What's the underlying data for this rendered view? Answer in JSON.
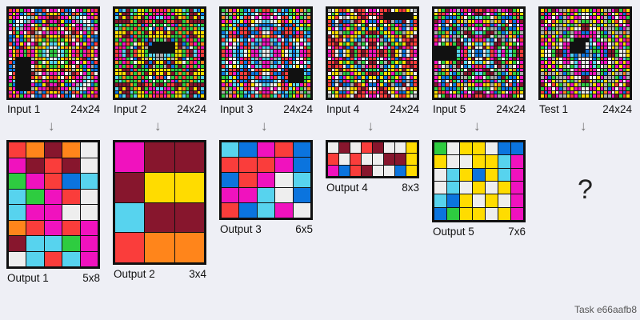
{
  "task_label": "Task e66aafb8",
  "test_unknown": "?",
  "arrow_glyph": "↓",
  "palette": {
    "K": "#111111",
    "B": "#0b74de",
    "R": "#fa3d3b",
    "G": "#2ecc40",
    "Y": "#ffdc00",
    "E": "#aaaaaa",
    "P": "#f012be",
    "O": "#ff851b",
    "C": "#57d3ee",
    "M": "#87162d",
    "W": "#eeeeee"
  },
  "inputs": [
    {
      "label": "Input 1",
      "size": "24x24",
      "rows": [
        "RPOGPPWBBRWPPWRBBWPPGOPR",
        "PYPBCORBEBOYYOBEBROCBPYP",
        "OPPWWCEYPPRMMRPPYECWWPPO",
        "GBWWCEPBBYMPPMYBBPECWWBG",
        "PCWCPPWYGPRGGRPGYWPPCWCP",
        "POCEPPRYRWYRRYWRYRPPECOP",
        "WRGPWRMEWPEPPEPWEMRWPGRW",
        "BBYBYYEOOMYYYYMOOEYYBYBB",
        "BEPBGRWOYGOGGOGYOWRGBPEB",
        "RBPYPWPMGWYCCYWGMPWPYPBR",
        "WOBMRYEYOYCWWCYOYEYRMBOW",
        "PYRPGRPYGCWGGWCGYPRGPRYP",
        "PYRPGRPYGCWGGWCGYPRGPRYP",
        "WOKKKKEYOYCWWCYOYEYRMBOW",
        "RBKKKKPMGWYCCYWGMPWPYPBR",
        "BEKKKKWOYGOGGOGYOWRGBPEB",
        "BBKKKKEOOMYYYYMOOEYYBYBB",
        "WRKKKKMEWPEPPEPWEMRWPGRW",
        "POKKKKRYRWYRRYWRYRPPECOP",
        "PCKKKKWYGPRGGRPGYWPPCWCP",
        "GBKKKKPBBYMPPMYBBPECWWBG",
        "OPKKKKEYPPRMMRPPYECWWPPO",
        "PYPBCORBEBOYYOBEBROCBPYP",
        "RPOGPPWBBRWPPWRBBWPPGOPR"
      ]
    },
    {
      "label": "Input 2",
      "size": "24x24",
      "rows": [
        "YBCMGCYYGOPRRPOGYYCGMCBY",
        "BYMMCGYYPGRPPRGPYYGCMMYB",
        "CMYMGOYMGPPCCPPGMYOGMYMC",
        "MMMMOGMMRRGMMGRRMMGOMMMM",
        "GCGOGGOBPGWGGWGPBOGGOGCG",
        "CGOGGRGRGWBRRBWGRGRGGOGC",
        "YYYMOGOGMYMYYMYMGOGOMYYY",
        "YYMMBRGGGYYYYYYGGGRBMMYY",
        "GPGRPGMGBMEGGEMBGMGPRGPG",
        "OGPRGWYYMBKKKKKKYMBGRPGO",
        "PRPGWBMYEKKKKKKKYMEBWGRP",
        "RPCMGRYYGKKKKKKKYYGRMCPR",
        "RPCMGRYYGCCEECCGYYGRMCPR",
        "PRPGWBMYEYCEECYEYMBWGRP",
        "OGPRGWYYMBMYYMBMYYWGRPGO",
        "GPGRPGMGBMEGGEMBGMGPRGPG",
        "YYMMBRGGGYYYYYYGGGRBMMYY",
        "YYYMOGOGMYMYYMYMGOGOMYYY",
        "CGOGGRGRGWBRRBWGRGRGGOGC",
        "GCGOGGOBPGWGGWGPBOGGOGCG",
        "MMMMOGMMRRGMMGRRMMGOMMMM",
        "CMYMGOYMGPPCCPPGMYOGMYMC",
        "BYMMCGYYPGRPPRGPYYGCMMYB",
        "YBCMGCYYGOPRRPOGYYCGMCBY"
      ]
    },
    {
      "label": "Input 3",
      "size": "24x24",
      "rows": [
        "GEOPYGBCRCGRRGCRCBGYPOEG",
        "EGEOGGCBCWRPPRWCBCGGOEGE",
        "OEGPYCRRWPWPPWPWRRCYPGEO",
        "POPCCYPRYWWCCWWYRPYCCPOP",
        "YGYCRBBMWCBBBBCWMBBRCYGY",
        "GGCYBRRBCRPCCPRCBRRBYCGG",
        "BCRPBRRMBBRWWRBBMRRBPRCB",
        "CBRRMBMBWRRYYRRWBMBMRRBC",
        "RCWYWCBWPCCPPCCPWBCWYWCR",
        "CWPWCRBRCBEPPEBCRBRCWPWC",
        "GRWWBPRRCEPCCPECRRPBWWRG",
        "RPPCBCWYPPCWWCPPYWCBCPPR",
        "RPPCBCWYPPCWWCPPYWCBCPPR",
        "GRWWBPRRCEPCCPECRRPBWWRG",
        "CWPWCRBRCBEPPEBCRBRCWPWC",
        "RCWYWCBWPCCPPCCPWBCWYWCR",
        "CBRRMBMBWRRYYRRWBMKKKKBC",
        "BCRPBRRMBBRWWRBBMRKKKKCB",
        "GGCYBRRBCRPCCPRCBRKKKKGG",
        "YGYCRBBMWCBBBBCWMBKKKKGY",
        "POPCCYPRYWWCCWWYRPYCCPOP",
        "OEGPYCRRWPWPPWPWRRCYPGEO",
        "EGEOGGCBCWRPPRWCBCGGOEGE",
        "GEOPYGBCRCGRRGCRCBGYPOEG"
      ]
    },
    {
      "label": "Input 4",
      "size": "24x24",
      "rows": [
        "EWYRRYWMRRWPPWRRMWYRRYWE",
        "WGYBBPYWMRPRRPRKKKKKKKKW",
        "YYRWEWYYRMRWWRMKKKKKKKKY",
        "RBWMBBEMRYPBBPYRMEBBMWBR",
        "RBEBRPGYWGMWWMGWYGPRBEBR",
        "YPWBPYGRBYBYYBYBRGYPBWPY",
        "WYYEGGPYYGRMMRGYYPGGEYYW",
        "MWYMYRYYCMCGGCMCYYRYMYWM",
        "RMRRWBYCBEPRRPEBCYBWRRMR",
        "RRMYGYGMEGWMMWGEMGYGYMRR",
        "WPRPMBRCPWCRRCWPCRBMPRPW",
        "PRWBWYMGRMRPPRMRGMYWBWRP",
        "PRWBWYMGRMRPPRMRGMYWBWRP",
        "WPRPMBRCPWCRRCWPCRBMPRPW",
        "RRMYGYGMEGWMMWGEMGYGYMRR",
        "RMRRWBYCBEPRRPEBCYBWRRMR",
        "MWYMYRYYCMCGGCMCYYRYMYWM",
        "WYYEGGPYYGRMMRGYYPGGEYYW",
        "YPWBPYGRBYBYYBYBRGYPBWPY",
        "RBEBRPGYWGMWWMGWYGPRBEBR",
        "RBWMBBEMRYPBBPYBMEBBMWBR",
        "YYRWEWYYRMRWWRMRYYWEWRYY",
        "WGYBBPYWMRPRRPRMWYPBBYGW",
        "EWYRRYWMRRWPPWRRMWYRRYWE"
      ]
    },
    {
      "label": "Input 5",
      "size": "24x24",
      "rows": [
        "WYGMPPEPRPMRRMPRPEPPMGYW",
        "YRRPWYGBPWPMMPWPBGYWPRRY",
        "GRGBBBGOWGGCCGGWOGBBBGRG",
        "MPBRWBOYEYYPPYYEYOBWRBPM",
        "PWBWRGCPBRPGGPRBPCGRWBWP",
        "PYBBGMBEEGWPPWGEEBMGBBYP",
        "EGGOCBGEMMGCCGMMEGBCOGGE",
        "PBOYPEEGWMMPPMMWGEEPYOBP",
        "RPWEBEMWBCPRRPCBWMEBEWPR",
        "PWGYRGMMCWYCCYWCMMGRYGWP",
        "KKKKKKGMPYMWWMYPMGWGPMPM",
        "KKKKKKCPRCWBBWCRPCPGCGMR",
        "KKKKKKCPRCWBBWCRPCPGCGMR",
        "KKKKKKGMPYMWWMYPMGWGPMPM",
        "PWGYRGMMCWYCCYWCMMGRYGWP",
        "RPWEBEMWBCPRRPCBWMEBEWPR",
        "PBOYPEEGWMMPPMMWGEEPYOBP",
        "EGGOCBGEMMGCCGMMEGBCOGGE",
        "PYBBGMBEEGWPPWGEEBMGBBYP",
        "PWBWRGCPBRPGGPRBPCGRWBWP",
        "MPBRWBOYEYYPPYYEYOBWRBPM",
        "GRGBBBGOWGGCCGGWOGBBBGRG",
        "YRRPWYGBPWPMMPWPBGYWPRRY",
        "YWGMPPEPRPMRRMPRPEPPMGYW"
      ]
    },
    {
      "label": "Test 1",
      "size": "24x24",
      "rows": [
        "YRGMPEEYRPGYYGPRYEEPMGRY",
        "RBPYWPOGPYCWWCYPGOPWYPBR",
        "GPPWPBEPYPPWWPPYPEBPWPPG",
        "MYWRYGEYPYEGGEYPYEGYRWYM",
        "PWPYEEYCGEYMMYEGCYEEYPWP",
        "EPBGEEEPYWWMMWWYPEEEGBPE",
        "EOEEYEBGEPPBBPPEGBEYEEOE",
        "YGPYCPGGWPRPPRPWGGPCYPGY",
        "RPYPGYEWGKKKKCPGWEYGPYPR",
        "PYPYEWPPKKKKWCWPPPWEYPYP",
        "GCPEYWPRKKKKWBGBRPWYEPCG",
        "YWWGMMBPKKKKBEGGPBMMGWWY",
        "YWWGMMBPCBEBBEBCPBMMGWWY",
        "GCPEYWPRGBWWWWBGRPWYEPCG",
        "PYPYEWPPWCPWWPCWPPWEYPYP",
        "RPYPGYEWGCPWWPCGWEYGPYPR",
        "YGPYCPGGWPRPPRPWGGPCYPGY",
        "EOEEYEBGEPPBBPPEGBEYEEOE",
        "EPBGEEEPYWWMMWWYPEEEGBPE",
        "PWPYEEYCGEYMMYEGCYEEYPWP",
        "MYWRYGEYPYEGGEYPYEGYRWYM",
        "GPPWPBEPYPPWWPPYPEBPWPPG",
        "RBPYWPOGPYCWWCYPGOPWYPBR",
        "YRGMPEEYRPGYYGPRYEEPMGRY"
      ]
    }
  ],
  "outputs": [
    {
      "label": "Output 1",
      "size": "5x8",
      "rows": [
        "ROMOW",
        "PMRMW",
        "GPRBC",
        "CGPRW",
        "CPPWW",
        "ORPRP",
        "MCCGP",
        "WCRCP"
      ]
    },
    {
      "label": "Output 2",
      "size": "3x4",
      "rows": [
        "PMM",
        "MYY",
        "CMM",
        "ROO"
      ]
    },
    {
      "label": "Output 3",
      "size": "6x5",
      "rows": [
        "CBPRB",
        "RRRPB",
        "BRPWC",
        "PPCWB",
        "RBCPW"
      ]
    },
    {
      "label": "Output 4",
      "size": "8x3",
      "rows": [
        "WMWRMWWY",
        "RWRWWMMY",
        "PBRMWWBY"
      ]
    },
    {
      "label": "Output 5",
      "size": "7x6",
      "rows": [
        "GWYYWBB",
        "YWWYYCP",
        "WCYBYCP",
        "WCWYWYP",
        "CBYWYWP",
        "BGYYWYP"
      ]
    }
  ]
}
